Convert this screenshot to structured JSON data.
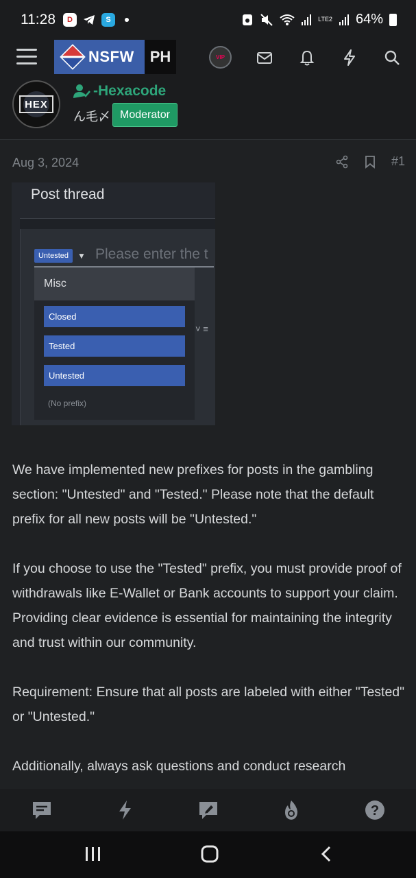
{
  "status_bar": {
    "time": "11:28",
    "battery": "64%",
    "network": "LTE2",
    "icons": [
      "red-app-icon",
      "telegram-icon",
      "shazam-icon",
      "dot-icon",
      "rotate-icon",
      "mute-icon",
      "wifi-icon",
      "signal-icon",
      "signal-icon",
      "battery-icon"
    ]
  },
  "header": {
    "logo_text": "NSFW",
    "logo_suffix": "PH",
    "vip_badge": "VIP",
    "icons": [
      "menu-icon",
      "vip-badge-icon",
      "inbox-icon",
      "bell-icon",
      "bolt-icon",
      "search-icon"
    ]
  },
  "author": {
    "avatar_text": "HEX",
    "name": "-Hexacode",
    "subtitle": "ん毛〆",
    "badge": "Moderator"
  },
  "post": {
    "date": "Aug 3, 2024",
    "number": "#1",
    "embedded_screenshot": {
      "title": "Post thread",
      "selected_prefix": "Untested",
      "title_placeholder": "Please enter the t",
      "group_label": "Misc",
      "options": [
        "Closed",
        "Tested",
        "Untested"
      ],
      "no_prefix": "(No prefix)"
    },
    "paragraphs": [
      "We have implemented new prefixes for posts in the gambling section: \"Untested\" and \"Tested.\" Please note that the default prefix for all new posts will be \"Untested.\"",
      "If you choose to use the \"Tested\" prefix, you must provide proof of withdrawals like E-Wallet or Bank accounts to support your claim. Providing clear evidence is essential for maintaining the integrity and trust within our community.",
      "Requirement: Ensure that all posts are labeled with either \"Tested\" or \"Untested.\"",
      "Additionally, always ask questions and conduct research"
    ]
  },
  "bottom_nav": {
    "items": [
      "forums-icon",
      "whats-new-icon",
      "post-icon",
      "trending-icon",
      "help-icon"
    ]
  },
  "system_nav": {
    "items": [
      "recent-apps-icon",
      "home-icon",
      "back-icon"
    ]
  },
  "colors": {
    "accent_green": "#1f9a64",
    "username_green": "#2ea57a",
    "prefix_blue": "#3a5fb0",
    "background": "#1f2123"
  }
}
